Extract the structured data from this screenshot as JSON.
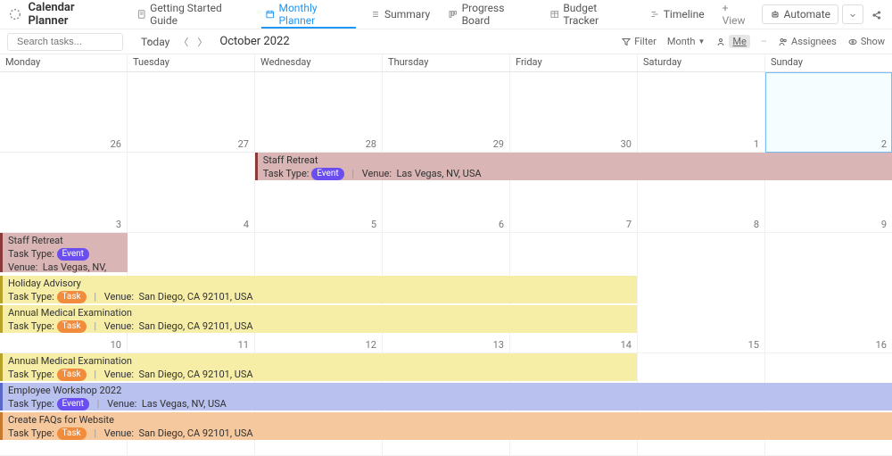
{
  "header": {
    "app_title": "Calendar Planner",
    "tabs": [
      {
        "label": "Getting Started Guide",
        "active": false
      },
      {
        "label": "Monthly Planner",
        "active": true
      },
      {
        "label": "Summary",
        "active": false
      },
      {
        "label": "Progress Board",
        "active": false
      },
      {
        "label": "Budget Tracker",
        "active": false
      },
      {
        "label": "Timeline",
        "active": false
      }
    ],
    "add_view": "+ View",
    "automate": "Automate"
  },
  "toolbar": {
    "search_placeholder": "Search tasks...",
    "today": "Today",
    "month_label": "October 2022",
    "filter": "Filter",
    "scale": "Month",
    "me": "Me",
    "assignees": "Assignees",
    "show": "Show"
  },
  "day_headers": [
    "Monday",
    "Tuesday",
    "Wednesday",
    "Thursday",
    "Friday",
    "Saturday",
    "Sunday"
  ],
  "week1_days": [
    "26",
    "27",
    "28",
    "29",
    "30",
    "1",
    "2"
  ],
  "week2_days": [
    "3",
    "4",
    "5",
    "6",
    "7",
    "8",
    "9"
  ],
  "week3_days": [
    "10",
    "11",
    "12",
    "13",
    "14",
    "15",
    "16"
  ],
  "week4_days": [
    "",
    "",
    "",
    "",
    "",
    "",
    ""
  ],
  "events": {
    "staff_retreat": {
      "title": "Staff Retreat",
      "type_label": "Task Type:",
      "type": "Event",
      "venue_label": "Venue:",
      "venue": "Las Vegas, NV, USA"
    },
    "staff_retreat2": {
      "title": "Staff Retreat",
      "type_label": "Task Type:",
      "type": "Event",
      "venue_label": "Venue:",
      "venue": "Las Vegas, NV, USA"
    },
    "holiday_advisory": {
      "title": "Holiday Advisory",
      "type_label": "Task Type:",
      "type": "Task",
      "venue_label": "Venue:",
      "venue": "San Diego, CA 92101, USA"
    },
    "medical1": {
      "title": "Annual Medical Examination",
      "type_label": "Task Type:",
      "type": "Task",
      "venue_label": "Venue:",
      "venue": "San Diego, CA 92101, USA"
    },
    "medical2": {
      "title": "Annual Medical Examination",
      "type_label": "Task Type:",
      "type": "Task",
      "venue_label": "Venue:",
      "venue": "San Diego, CA 92101, USA"
    },
    "workshop": {
      "title": "Employee Workshop 2022",
      "type_label": "Task Type:",
      "type": "Event",
      "venue_label": "Venue:",
      "venue": "Las Vegas, NV, USA"
    },
    "faqs": {
      "title": "Create FAQs for Website",
      "type_label": "Task Type:",
      "type": "Task",
      "venue_label": "Venue:",
      "venue": "San Diego, CA 92101, USA"
    }
  }
}
